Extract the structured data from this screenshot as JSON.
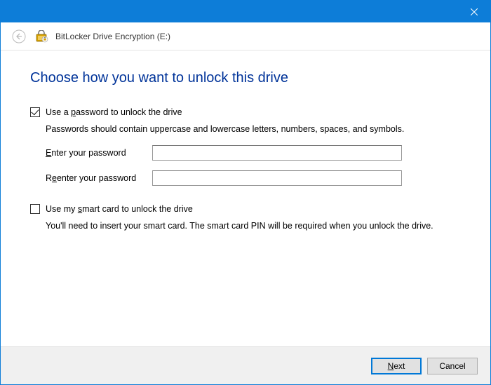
{
  "header": {
    "title": "BitLocker Drive Encryption (E:)"
  },
  "main": {
    "heading": "Choose how you want to unlock this drive",
    "password": {
      "label_pre": "Use a ",
      "label_u": "p",
      "label_post": "assword to unlock the drive",
      "help": "Passwords should contain uppercase and lowercase letters, numbers, spaces, and symbols.",
      "enter_u": "E",
      "enter_post": "nter your password",
      "reenter_pre": "R",
      "reenter_u": "e",
      "reenter_post": "enter your password",
      "enter_value": "",
      "reenter_value": ""
    },
    "smartcard": {
      "label_pre": "Use my ",
      "label_u": "s",
      "label_post": "mart card to unlock the drive",
      "help": "You'll need to insert your smart card. The smart card PIN will be required when you unlock the drive."
    }
  },
  "footer": {
    "next_u": "N",
    "next_post": "ext",
    "cancel": "Cancel"
  }
}
